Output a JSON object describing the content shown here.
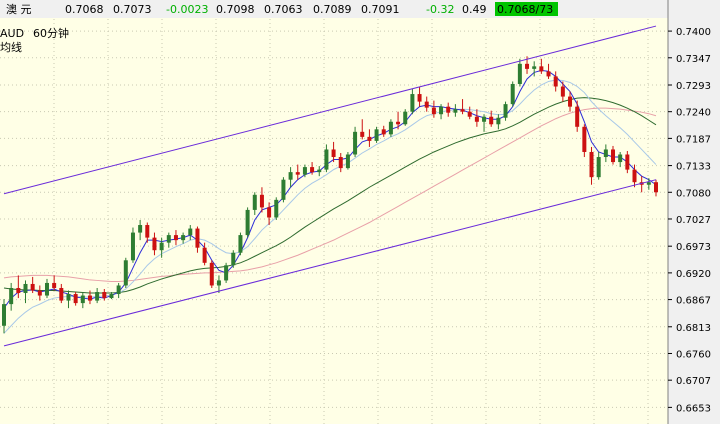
{
  "header": {
    "symbol": "澳 元",
    "q1": "0.7068",
    "q2": "0.7073",
    "change": "-0.0023",
    "q4": "0.7098",
    "q5": "0.7063",
    "q6": "0.7089",
    "q7": "0.7091",
    "change_pct": "-0.32",
    "q9": "0.49",
    "bid_ask": "0.7068/73"
  },
  "panel": {
    "instrument": "AUD",
    "period": "60分钟",
    "sub": "均线"
  },
  "colors": {
    "background": "#ffffe6",
    "header_bg": "#f0f0f0",
    "grid": "#c9c9b3",
    "up_candle": "#2e7d32",
    "down_candle": "#cc1111",
    "channel": "#6a2bd9",
    "ma_fast": "#2d2dd8",
    "ma_mid": "#a8c8e8",
    "ma_slow": "#2f6b2f",
    "ma_long": "#e8a0a8",
    "change_green": "#00b000"
  },
  "chart_data": {
    "type": "candlestick",
    "y_ticks": [
      "0.7400",
      "0.7347",
      "0.7293",
      "0.7240",
      "0.7187",
      "0.7133",
      "0.7080",
      "0.7027",
      "0.6973",
      "0.6920",
      "0.6867",
      "0.6813",
      "0.6760",
      "0.6707",
      "0.6653"
    ],
    "y_range": [
      0.662,
      0.7424
    ],
    "grid": true,
    "candles": [
      [
        0.6815,
        0.6868,
        0.68,
        0.6858
      ],
      [
        0.6858,
        0.69,
        0.6845,
        0.689
      ],
      [
        0.689,
        0.6915,
        0.687,
        0.688
      ],
      [
        0.688,
        0.6905,
        0.686,
        0.6898
      ],
      [
        0.6898,
        0.6912,
        0.688,
        0.6885
      ],
      [
        0.6885,
        0.6895,
        0.6865,
        0.6875
      ],
      [
        0.6875,
        0.6908,
        0.687,
        0.69
      ],
      [
        0.69,
        0.6915,
        0.6885,
        0.689
      ],
      [
        0.689,
        0.6898,
        0.686,
        0.6865
      ],
      [
        0.6865,
        0.6885,
        0.685,
        0.6878
      ],
      [
        0.6878,
        0.6882,
        0.6855,
        0.686
      ],
      [
        0.686,
        0.688,
        0.685,
        0.6875
      ],
      [
        0.6875,
        0.6885,
        0.6858,
        0.6865
      ],
      [
        0.6865,
        0.689,
        0.686,
        0.6882
      ],
      [
        0.6882,
        0.6888,
        0.6865,
        0.687
      ],
      [
        0.687,
        0.6882,
        0.6868,
        0.6878
      ],
      [
        0.6878,
        0.69,
        0.687,
        0.6895
      ],
      [
        0.6895,
        0.695,
        0.689,
        0.6945
      ],
      [
        0.6945,
        0.701,
        0.694,
        0.7
      ],
      [
        0.7,
        0.7025,
        0.6985,
        0.7015
      ],
      [
        0.7015,
        0.702,
        0.698,
        0.699
      ],
      [
        0.699,
        0.7,
        0.6955,
        0.6965
      ],
      [
        0.6965,
        0.699,
        0.695,
        0.698
      ],
      [
        0.698,
        0.7,
        0.697,
        0.6995
      ],
      [
        0.6995,
        0.7005,
        0.6975,
        0.6985
      ],
      [
        0.6985,
        0.7,
        0.6978,
        0.6995
      ],
      [
        0.6995,
        0.7015,
        0.6985,
        0.7008
      ],
      [
        0.7008,
        0.7012,
        0.696,
        0.697
      ],
      [
        0.697,
        0.698,
        0.6935,
        0.694
      ],
      [
        0.694,
        0.6945,
        0.689,
        0.6895
      ],
      [
        0.6895,
        0.6915,
        0.688,
        0.6905
      ],
      [
        0.6905,
        0.694,
        0.69,
        0.6935
      ],
      [
        0.6935,
        0.6965,
        0.693,
        0.696
      ],
      [
        0.696,
        0.7,
        0.6955,
        0.6995
      ],
      [
        0.6995,
        0.705,
        0.699,
        0.7045
      ],
      [
        0.7045,
        0.708,
        0.7035,
        0.7075
      ],
      [
        0.7075,
        0.709,
        0.704,
        0.705
      ],
      [
        0.705,
        0.706,
        0.7015,
        0.703
      ],
      [
        0.703,
        0.707,
        0.7025,
        0.7065
      ],
      [
        0.7065,
        0.711,
        0.706,
        0.7105
      ],
      [
        0.7105,
        0.713,
        0.709,
        0.712
      ],
      [
        0.712,
        0.7135,
        0.7105,
        0.7115
      ],
      [
        0.7115,
        0.7135,
        0.711,
        0.713
      ],
      [
        0.713,
        0.714,
        0.7115,
        0.712
      ],
      [
        0.712,
        0.7132,
        0.7112,
        0.7125
      ],
      [
        0.7125,
        0.7175,
        0.712,
        0.7165
      ],
      [
        0.7165,
        0.718,
        0.714,
        0.715
      ],
      [
        0.715,
        0.7158,
        0.712,
        0.7128
      ],
      [
        0.7128,
        0.716,
        0.7125,
        0.7155
      ],
      [
        0.7155,
        0.721,
        0.715,
        0.72
      ],
      [
        0.72,
        0.7225,
        0.7185,
        0.719
      ],
      [
        0.719,
        0.7205,
        0.717,
        0.7182
      ],
      [
        0.7182,
        0.721,
        0.7178,
        0.7205
      ],
      [
        0.7205,
        0.7212,
        0.719,
        0.7195
      ],
      [
        0.7195,
        0.7225,
        0.719,
        0.722
      ],
      [
        0.722,
        0.724,
        0.7205,
        0.7215
      ],
      [
        0.7215,
        0.7245,
        0.7212,
        0.724
      ],
      [
        0.724,
        0.7285,
        0.7235,
        0.7275
      ],
      [
        0.7275,
        0.729,
        0.725,
        0.726
      ],
      [
        0.726,
        0.727,
        0.724,
        0.7248
      ],
      [
        0.7248,
        0.7262,
        0.7228,
        0.7235
      ],
      [
        0.7235,
        0.7255,
        0.7225,
        0.725
      ],
      [
        0.725,
        0.7258,
        0.723,
        0.7238
      ],
      [
        0.7238,
        0.7255,
        0.723,
        0.7245
      ],
      [
        0.7245,
        0.7265,
        0.7235,
        0.724
      ],
      [
        0.724,
        0.725,
        0.7225,
        0.723
      ],
      [
        0.723,
        0.7245,
        0.721,
        0.722
      ],
      [
        0.722,
        0.7235,
        0.72,
        0.723
      ],
      [
        0.723,
        0.7242,
        0.721,
        0.7215
      ],
      [
        0.7215,
        0.7235,
        0.7205,
        0.7228
      ],
      [
        0.7228,
        0.726,
        0.7222,
        0.7255
      ],
      [
        0.7255,
        0.73,
        0.725,
        0.7295
      ],
      [
        0.7295,
        0.7345,
        0.729,
        0.7335
      ],
      [
        0.7335,
        0.735,
        0.7315,
        0.7325
      ],
      [
        0.7325,
        0.734,
        0.731,
        0.733
      ],
      [
        0.733,
        0.7345,
        0.7315,
        0.732
      ],
      [
        0.732,
        0.7335,
        0.7305,
        0.731
      ],
      [
        0.731,
        0.732,
        0.728,
        0.729
      ],
      [
        0.729,
        0.73,
        0.726,
        0.727
      ],
      [
        0.727,
        0.728,
        0.724,
        0.725
      ],
      [
        0.725,
        0.7262,
        0.72,
        0.721
      ],
      [
        0.721,
        0.7215,
        0.715,
        0.716
      ],
      [
        0.716,
        0.717,
        0.7095,
        0.711
      ],
      [
        0.711,
        0.716,
        0.7105,
        0.715
      ],
      [
        0.715,
        0.7175,
        0.714,
        0.7165
      ],
      [
        0.7165,
        0.7172,
        0.7135,
        0.714
      ],
      [
        0.714,
        0.716,
        0.713,
        0.7155
      ],
      [
        0.7155,
        0.7162,
        0.7118,
        0.7125
      ],
      [
        0.7125,
        0.7135,
        0.709,
        0.71
      ],
      [
        0.71,
        0.7112,
        0.708,
        0.7095
      ],
      [
        0.7095,
        0.7108,
        0.7085,
        0.71
      ],
      [
        0.71,
        0.7105,
        0.7072,
        0.708
      ]
    ],
    "ma_fast": [
      0.685,
      0.687,
      0.6882,
      0.6885,
      0.6886,
      0.6882,
      0.6885,
      0.6888,
      0.6882,
      0.6878,
      0.6872,
      0.687,
      0.6868,
      0.6872,
      0.687,
      0.6875,
      0.6882,
      0.69,
      0.693,
      0.696,
      0.6985,
      0.6985,
      0.6982,
      0.6985,
      0.6987,
      0.699,
      0.6995,
      0.6985,
      0.697,
      0.6945,
      0.6925,
      0.692,
      0.6935,
      0.696,
      0.699,
      0.7025,
      0.7045,
      0.705,
      0.7055,
      0.707,
      0.709,
      0.7105,
      0.7115,
      0.712,
      0.7122,
      0.7135,
      0.7145,
      0.7145,
      0.7148,
      0.7165,
      0.718,
      0.7185,
      0.7192,
      0.7197,
      0.7205,
      0.721,
      0.722,
      0.7238,
      0.725,
      0.7253,
      0.725,
      0.725,
      0.7247,
      0.7245,
      0.7243,
      0.7238,
      0.7232,
      0.7228,
      0.7225,
      0.7225,
      0.7232,
      0.725,
      0.728,
      0.7305,
      0.7318,
      0.7322,
      0.732,
      0.731,
      0.7295,
      0.728,
      0.7255,
      0.722,
      0.718,
      0.716,
      0.7155,
      0.715,
      0.715,
      0.714,
      0.7125,
      0.7112,
      0.7105,
      0.7095
    ],
    "ma_mid": [
      0.68,
      0.6815,
      0.683,
      0.6842,
      0.6852,
      0.6858,
      0.6865,
      0.687,
      0.6872,
      0.6873,
      0.6873,
      0.6872,
      0.6872,
      0.6873,
      0.6874,
      0.6876,
      0.688,
      0.6888,
      0.6902,
      0.6918,
      0.6935,
      0.6948,
      0.6958,
      0.6965,
      0.6972,
      0.6978,
      0.6985,
      0.6988,
      0.6985,
      0.6978,
      0.6968,
      0.696,
      0.6958,
      0.6962,
      0.6972,
      0.6988,
      0.7005,
      0.7018,
      0.703,
      0.7045,
      0.706,
      0.7075,
      0.7088,
      0.7098,
      0.7106,
      0.7115,
      0.7125,
      0.7132,
      0.7138,
      0.7148,
      0.7158,
      0.7166,
      0.7175,
      0.7182,
      0.719,
      0.7196,
      0.7204,
      0.7214,
      0.7224,
      0.7232,
      0.7236,
      0.724,
      0.7242,
      0.7244,
      0.7245,
      0.7244,
      0.7242,
      0.724,
      0.7236,
      0.7234,
      0.7235,
      0.7242,
      0.7255,
      0.727,
      0.7283,
      0.7293,
      0.73,
      0.7303,
      0.7302,
      0.7298,
      0.729,
      0.7278,
      0.726,
      0.7245,
      0.7232,
      0.722,
      0.7208,
      0.7195,
      0.718,
      0.7165,
      0.715,
      0.7135
    ],
    "ma_slow": [
      0.689,
      0.6888,
      0.6887,
      0.6886,
      0.6886,
      0.6885,
      0.6885,
      0.6885,
      0.6884,
      0.6883,
      0.6882,
      0.6881,
      0.688,
      0.688,
      0.688,
      0.688,
      0.6881,
      0.6883,
      0.6887,
      0.6892,
      0.6898,
      0.6903,
      0.6908,
      0.6912,
      0.6916,
      0.692,
      0.6924,
      0.6927,
      0.6929,
      0.693,
      0.6931,
      0.6933,
      0.6936,
      0.694,
      0.6946,
      0.6953,
      0.696,
      0.6967,
      0.6974,
      0.6982,
      0.6991,
      0.7001,
      0.7011,
      0.702,
      0.7029,
      0.7038,
      0.7047,
      0.7055,
      0.7063,
      0.7072,
      0.7081,
      0.709,
      0.7098,
      0.7106,
      0.7114,
      0.7122,
      0.713,
      0.7138,
      0.7146,
      0.7153,
      0.716,
      0.7166,
      0.7172,
      0.7178,
      0.7183,
      0.7188,
      0.7192,
      0.7196,
      0.7199,
      0.7202,
      0.7206,
      0.7212,
      0.7219,
      0.7227,
      0.7235,
      0.7242,
      0.7249,
      0.7255,
      0.726,
      0.7264,
      0.7267,
      0.7268,
      0.7267,
      0.7265,
      0.7262,
      0.7258,
      0.7253,
      0.7247,
      0.724,
      0.7232,
      0.7223,
      0.7214
    ],
    "ma_long": [
      0.691,
      0.6912,
      0.6913,
      0.6914,
      0.6915,
      0.6915,
      0.6915,
      0.6914,
      0.6913,
      0.6912,
      0.691,
      0.6908,
      0.6906,
      0.6905,
      0.6904,
      0.6903,
      0.6903,
      0.6904,
      0.6905,
      0.6907,
      0.6909,
      0.6911,
      0.6913,
      0.6914,
      0.6916,
      0.6917,
      0.6918,
      0.6919,
      0.692,
      0.692,
      0.6921,
      0.6922,
      0.6923,
      0.6924,
      0.6926,
      0.6929,
      0.6932,
      0.6936,
      0.694,
      0.6945,
      0.695,
      0.6955,
      0.6961,
      0.6967,
      0.6973,
      0.6979,
      0.6985,
      0.6992,
      0.6999,
      0.7006,
      0.7013,
      0.702,
      0.7028,
      0.7036,
      0.7044,
      0.7052,
      0.706,
      0.7068,
      0.7076,
      0.7084,
      0.7092,
      0.71,
      0.7108,
      0.7116,
      0.7124,
      0.7132,
      0.714,
      0.7148,
      0.7156,
      0.7164,
      0.7172,
      0.718,
      0.7188,
      0.7196,
      0.7204,
      0.7212,
      0.7219,
      0.7226,
      0.7232,
      0.7237,
      0.7241,
      0.7244,
      0.7246,
      0.7247,
      0.7247,
      0.7246,
      0.7245,
      0.7243,
      0.7241,
      0.7239,
      0.7236,
      0.7232
    ],
    "channel_upper": [
      [
        0,
        0.7077
      ],
      [
        91,
        0.741
      ]
    ],
    "channel_lower": [
      [
        0,
        0.6775
      ],
      [
        91,
        0.7105
      ]
    ]
  }
}
